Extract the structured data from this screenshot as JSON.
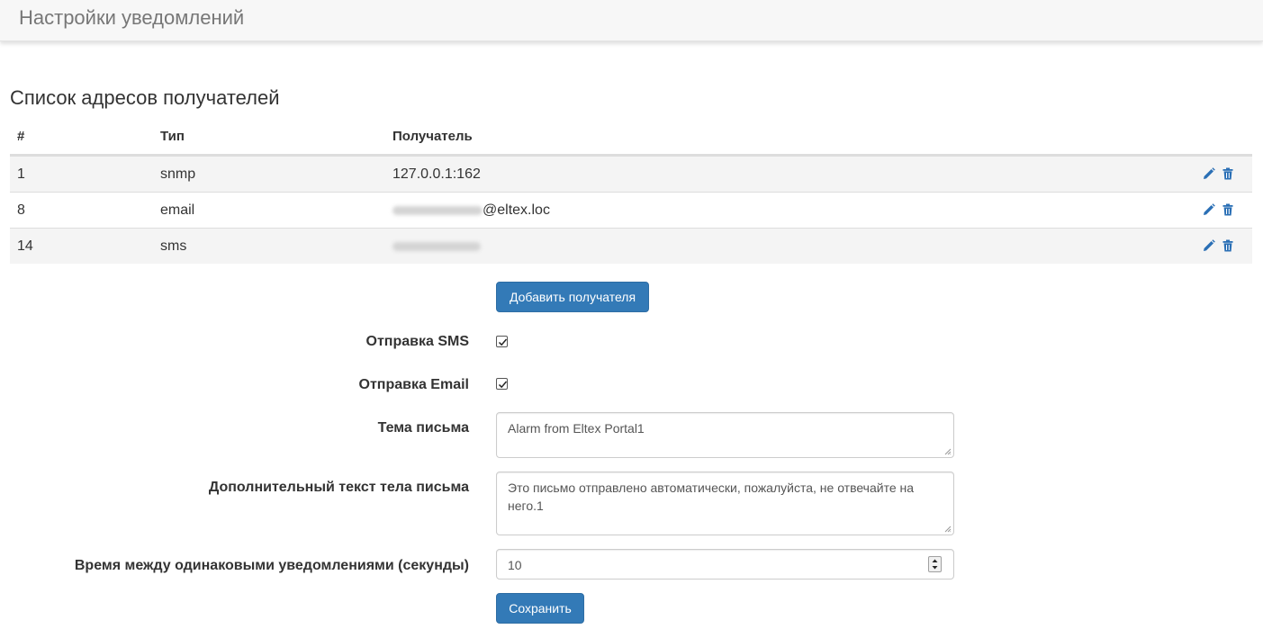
{
  "page": {
    "title": "Настройки уведомлений"
  },
  "recipients": {
    "title": "Список адресов получателей",
    "headers": [
      "#",
      "Тип",
      "Получатель"
    ],
    "rows": [
      {
        "id": "1",
        "type": "snmp",
        "recipient": "127.0.0.1:162"
      },
      {
        "id": "8",
        "type": "email",
        "recipient": "@eltex.loc"
      },
      {
        "id": "14",
        "type": "sms",
        "recipient": ""
      }
    ],
    "add_button": "Добавить получателя"
  },
  "form": {
    "sms_label": "Отправка SMS",
    "sms_checked": true,
    "email_label": "Отправка Email",
    "email_checked": true,
    "subject_label": "Тема письма",
    "subject_value": "Alarm from Eltex Portal1",
    "body_label": "Дополнительный текст тела письма",
    "body_value": "Это письмо отправлено автоматически, пожалуйста, не отвечайте на него.1",
    "interval_label": "Время между одинаковыми уведомлениями (секунды)",
    "interval_value": "10",
    "save_button": "Сохранить"
  },
  "icons": {
    "edit": "pencil-icon",
    "delete": "trash-icon"
  },
  "colors": {
    "primary": "#337ab7",
    "action_icon": "#2a6fb5"
  }
}
